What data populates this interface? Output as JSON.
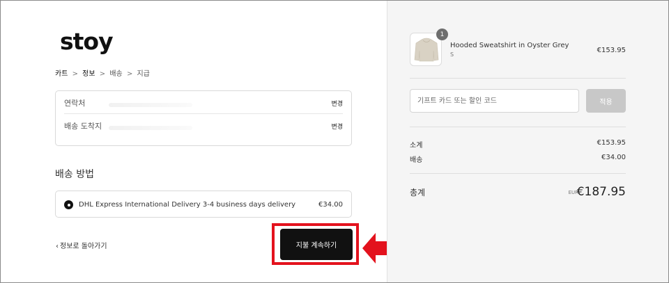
{
  "brand": {
    "logo_text": "stoy"
  },
  "breadcrumb": {
    "items": [
      "카트",
      "정보",
      "배송",
      "지급"
    ],
    "separator": ">"
  },
  "contact": {
    "contact_label": "연락처",
    "ship_to_label": "배송 도착지",
    "change_label": "변경"
  },
  "shipping": {
    "title": "배송 방법",
    "method_name": "DHL Express International Delivery 3-4 business days delivery",
    "method_price": "€34.00"
  },
  "actions": {
    "back_label": "정보로 돌아가기",
    "continue_label": "지불 계속하기"
  },
  "annotation": {
    "highlight_color": "#e3121d"
  },
  "order": {
    "product_name": "Hooded Sweatshirt in Oyster Grey",
    "product_variant": "S",
    "product_price": "€153.95",
    "quantity": "1",
    "discount_placeholder": "기프트 카드 또는 할인 코드",
    "apply_label": "적용",
    "subtotal_label": "소계",
    "subtotal_value": "€153.95",
    "shipping_label": "배송",
    "shipping_value": "€34.00",
    "total_label": "총계",
    "total_currency": "EUR",
    "total_value": "€187.95"
  },
  "colors": {
    "button_dark": "#111111",
    "apply_disabled": "#c8c8c8",
    "sidebar_bg": "#f5f5f5"
  }
}
